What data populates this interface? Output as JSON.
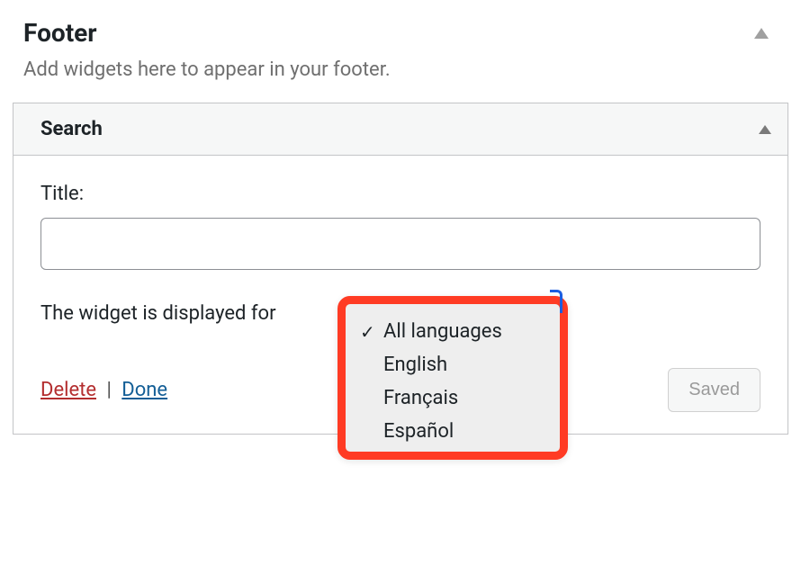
{
  "section": {
    "title": "Footer",
    "description": "Add widgets here to appear in your footer."
  },
  "widget": {
    "header_title": "Search",
    "title_label": "Title:",
    "title_value": "",
    "displayed_for_label": "The widget is displayed for",
    "delete_label": "Delete",
    "divider": "|",
    "done_label": "Done",
    "saved_label": "Saved"
  },
  "dropdown": {
    "items": [
      {
        "label": "All languages",
        "checked": true
      },
      {
        "label": "English",
        "checked": false
      },
      {
        "label": "Français",
        "checked": false
      },
      {
        "label": "Español",
        "checked": false
      }
    ]
  }
}
